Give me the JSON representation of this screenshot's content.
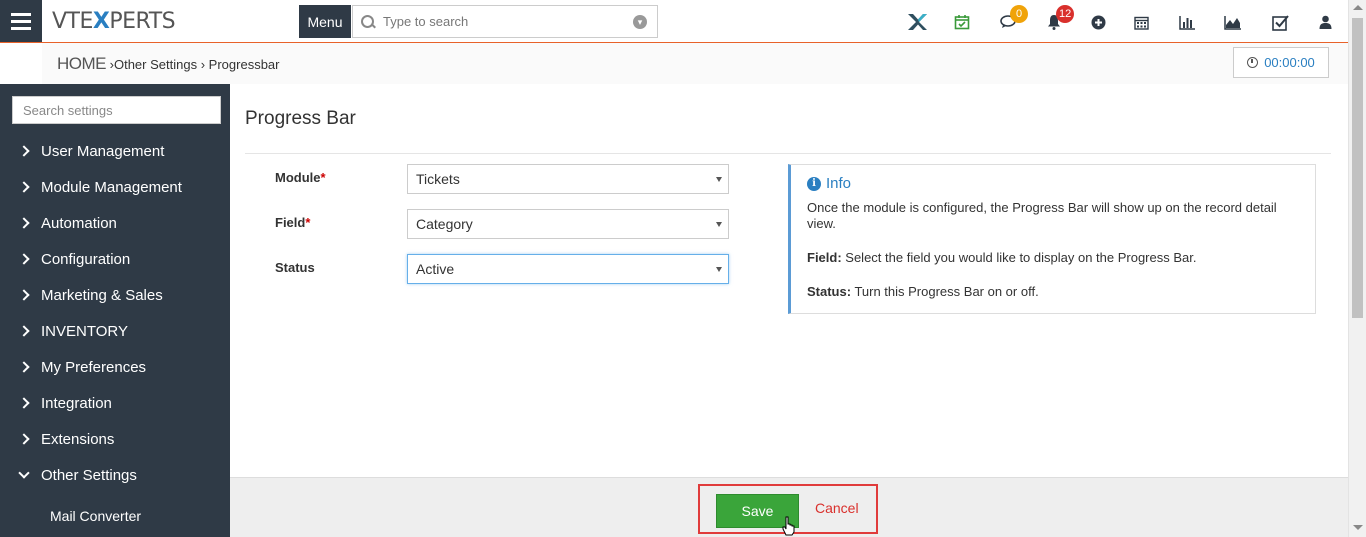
{
  "header": {
    "logo_prefix": "VTE",
    "logo_x": "X",
    "logo_suffix": "PERTS",
    "menu_label": "Menu",
    "search_placeholder": "Type to search",
    "icons": [
      "vtx-logo-icon",
      "calendar-check-icon",
      "chat-icon",
      "bell-icon",
      "plus-circle-icon",
      "calendar-icon",
      "bar-chart-icon",
      "area-chart-icon",
      "checkbox-icon",
      "user-icon"
    ],
    "chat_badge": "0",
    "bell_badge": "12",
    "accent_color": "#e8622a",
    "chat_badge_color": "#f0a30a",
    "bell_badge_color": "#d9302c"
  },
  "breadcrumb": {
    "home": "HOME",
    "item1": "Other Settings",
    "item2": "Progressbar"
  },
  "timer": {
    "value": "00:00:00"
  },
  "sidebar": {
    "search_placeholder": "Search settings",
    "items": [
      {
        "label": "User Management"
      },
      {
        "label": "Module Management"
      },
      {
        "label": "Automation"
      },
      {
        "label": "Configuration"
      },
      {
        "label": "Marketing & Sales"
      },
      {
        "label": "INVENTORY"
      },
      {
        "label": "My Preferences"
      },
      {
        "label": "Integration"
      },
      {
        "label": "Extensions"
      },
      {
        "label": "Other Settings"
      }
    ],
    "sub_item": "Mail Converter"
  },
  "main": {
    "title": "Progress Bar",
    "fields": [
      {
        "label": "Module",
        "required": "*",
        "value": "Tickets"
      },
      {
        "label": "Field",
        "required": "*",
        "value": "Category"
      },
      {
        "label": "Status",
        "required": "",
        "value": "Active"
      }
    ]
  },
  "info": {
    "heading": "Info",
    "intro": "Once the module is configured, the Progress Bar will show up on the record detail view.",
    "field_label": "Field:",
    "field_text": " Select the field you would like to display on the Progress Bar.",
    "status_label": "Status:",
    "status_text": " Turn this Progress Bar on or off."
  },
  "footer": {
    "save_label": "Save",
    "cancel_label": "Cancel"
  }
}
